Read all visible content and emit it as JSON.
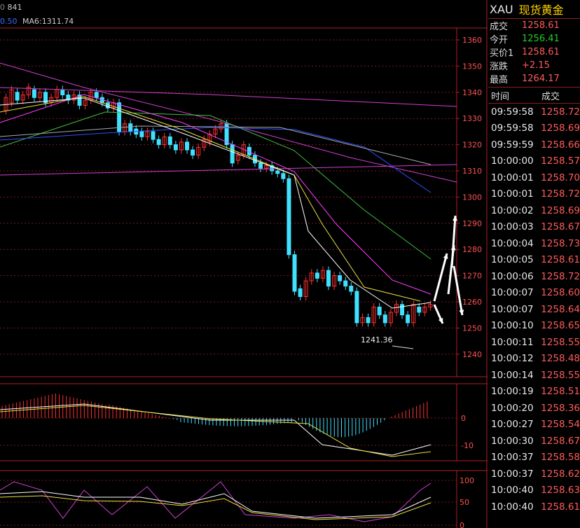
{
  "header": {
    "top_value": "841",
    "ma_prefix": "0.50",
    "ma6_label": "MA6:1311.74"
  },
  "quote": {
    "symbol": "XAU",
    "name": "现货黄金",
    "rows": [
      {
        "label": "成交",
        "value": "1258.61",
        "color": "red"
      },
      {
        "label": "今开",
        "value": "1256.41",
        "color": "green"
      },
      {
        "label": "买价1",
        "value": "1258.61",
        "color": "red"
      },
      {
        "label": "涨跌",
        "value": "+2.15",
        "color": "red"
      },
      {
        "label": "最高",
        "value": "1264.17",
        "color": "red"
      }
    ],
    "tick_header": {
      "time": "时间",
      "price": "成交"
    },
    "ticks": [
      {
        "time": "09:59:58",
        "price": "1258.72"
      },
      {
        "time": "09:59:58",
        "price": "1258.69"
      },
      {
        "time": "09:59:59",
        "price": "1258.66"
      },
      {
        "time": "10:00:00",
        "price": "1258.57"
      },
      {
        "time": "10:00:01",
        "price": "1258.70"
      },
      {
        "time": "10:00:01",
        "price": "1258.72"
      },
      {
        "time": "10:00:02",
        "price": "1258.69"
      },
      {
        "time": "10:00:03",
        "price": "1258.67"
      },
      {
        "time": "10:00:04",
        "price": "1258.73"
      },
      {
        "time": "10:00:05",
        "price": "1258.61"
      },
      {
        "time": "10:00:06",
        "price": "1258.72"
      },
      {
        "time": "10:00:07",
        "price": "1258.60"
      },
      {
        "time": "10:00:07",
        "price": "1258.64"
      },
      {
        "time": "10:00:10",
        "price": "1258.65"
      },
      {
        "time": "10:00:11",
        "price": "1258.55"
      },
      {
        "time": "10:00:12",
        "price": "1258.48"
      },
      {
        "time": "10:00:14",
        "price": "1258.55"
      },
      {
        "time": "10:00:19",
        "price": "1258.51"
      },
      {
        "time": "10:00:20",
        "price": "1258.36"
      },
      {
        "time": "10:00:27",
        "price": "1258.54"
      },
      {
        "time": "10:00:30",
        "price": "1258.67"
      },
      {
        "time": "10:00:37",
        "price": "1258.58"
      },
      {
        "time": "10:00:37",
        "price": "1258.62"
      },
      {
        "time": "10:00:40",
        "price": "1258.63"
      },
      {
        "time": "10:00:40",
        "price": "1258.61"
      }
    ]
  },
  "price_axis": [
    "1360",
    "1350",
    "1340",
    "1330",
    "1320",
    "1310",
    "1300",
    "1290",
    "1280",
    "1270",
    "1260",
    "1250",
    "1240"
  ],
  "macd_axis": [
    "0",
    "-10"
  ],
  "kdj_axis": [
    "100",
    "50",
    "0"
  ],
  "low_label": "1241.36",
  "colors": {
    "red": "#ff5b5b",
    "green": "#20d020",
    "border": "#b02020",
    "bull": "#ff3030",
    "bear": "#40e0ff"
  }
}
